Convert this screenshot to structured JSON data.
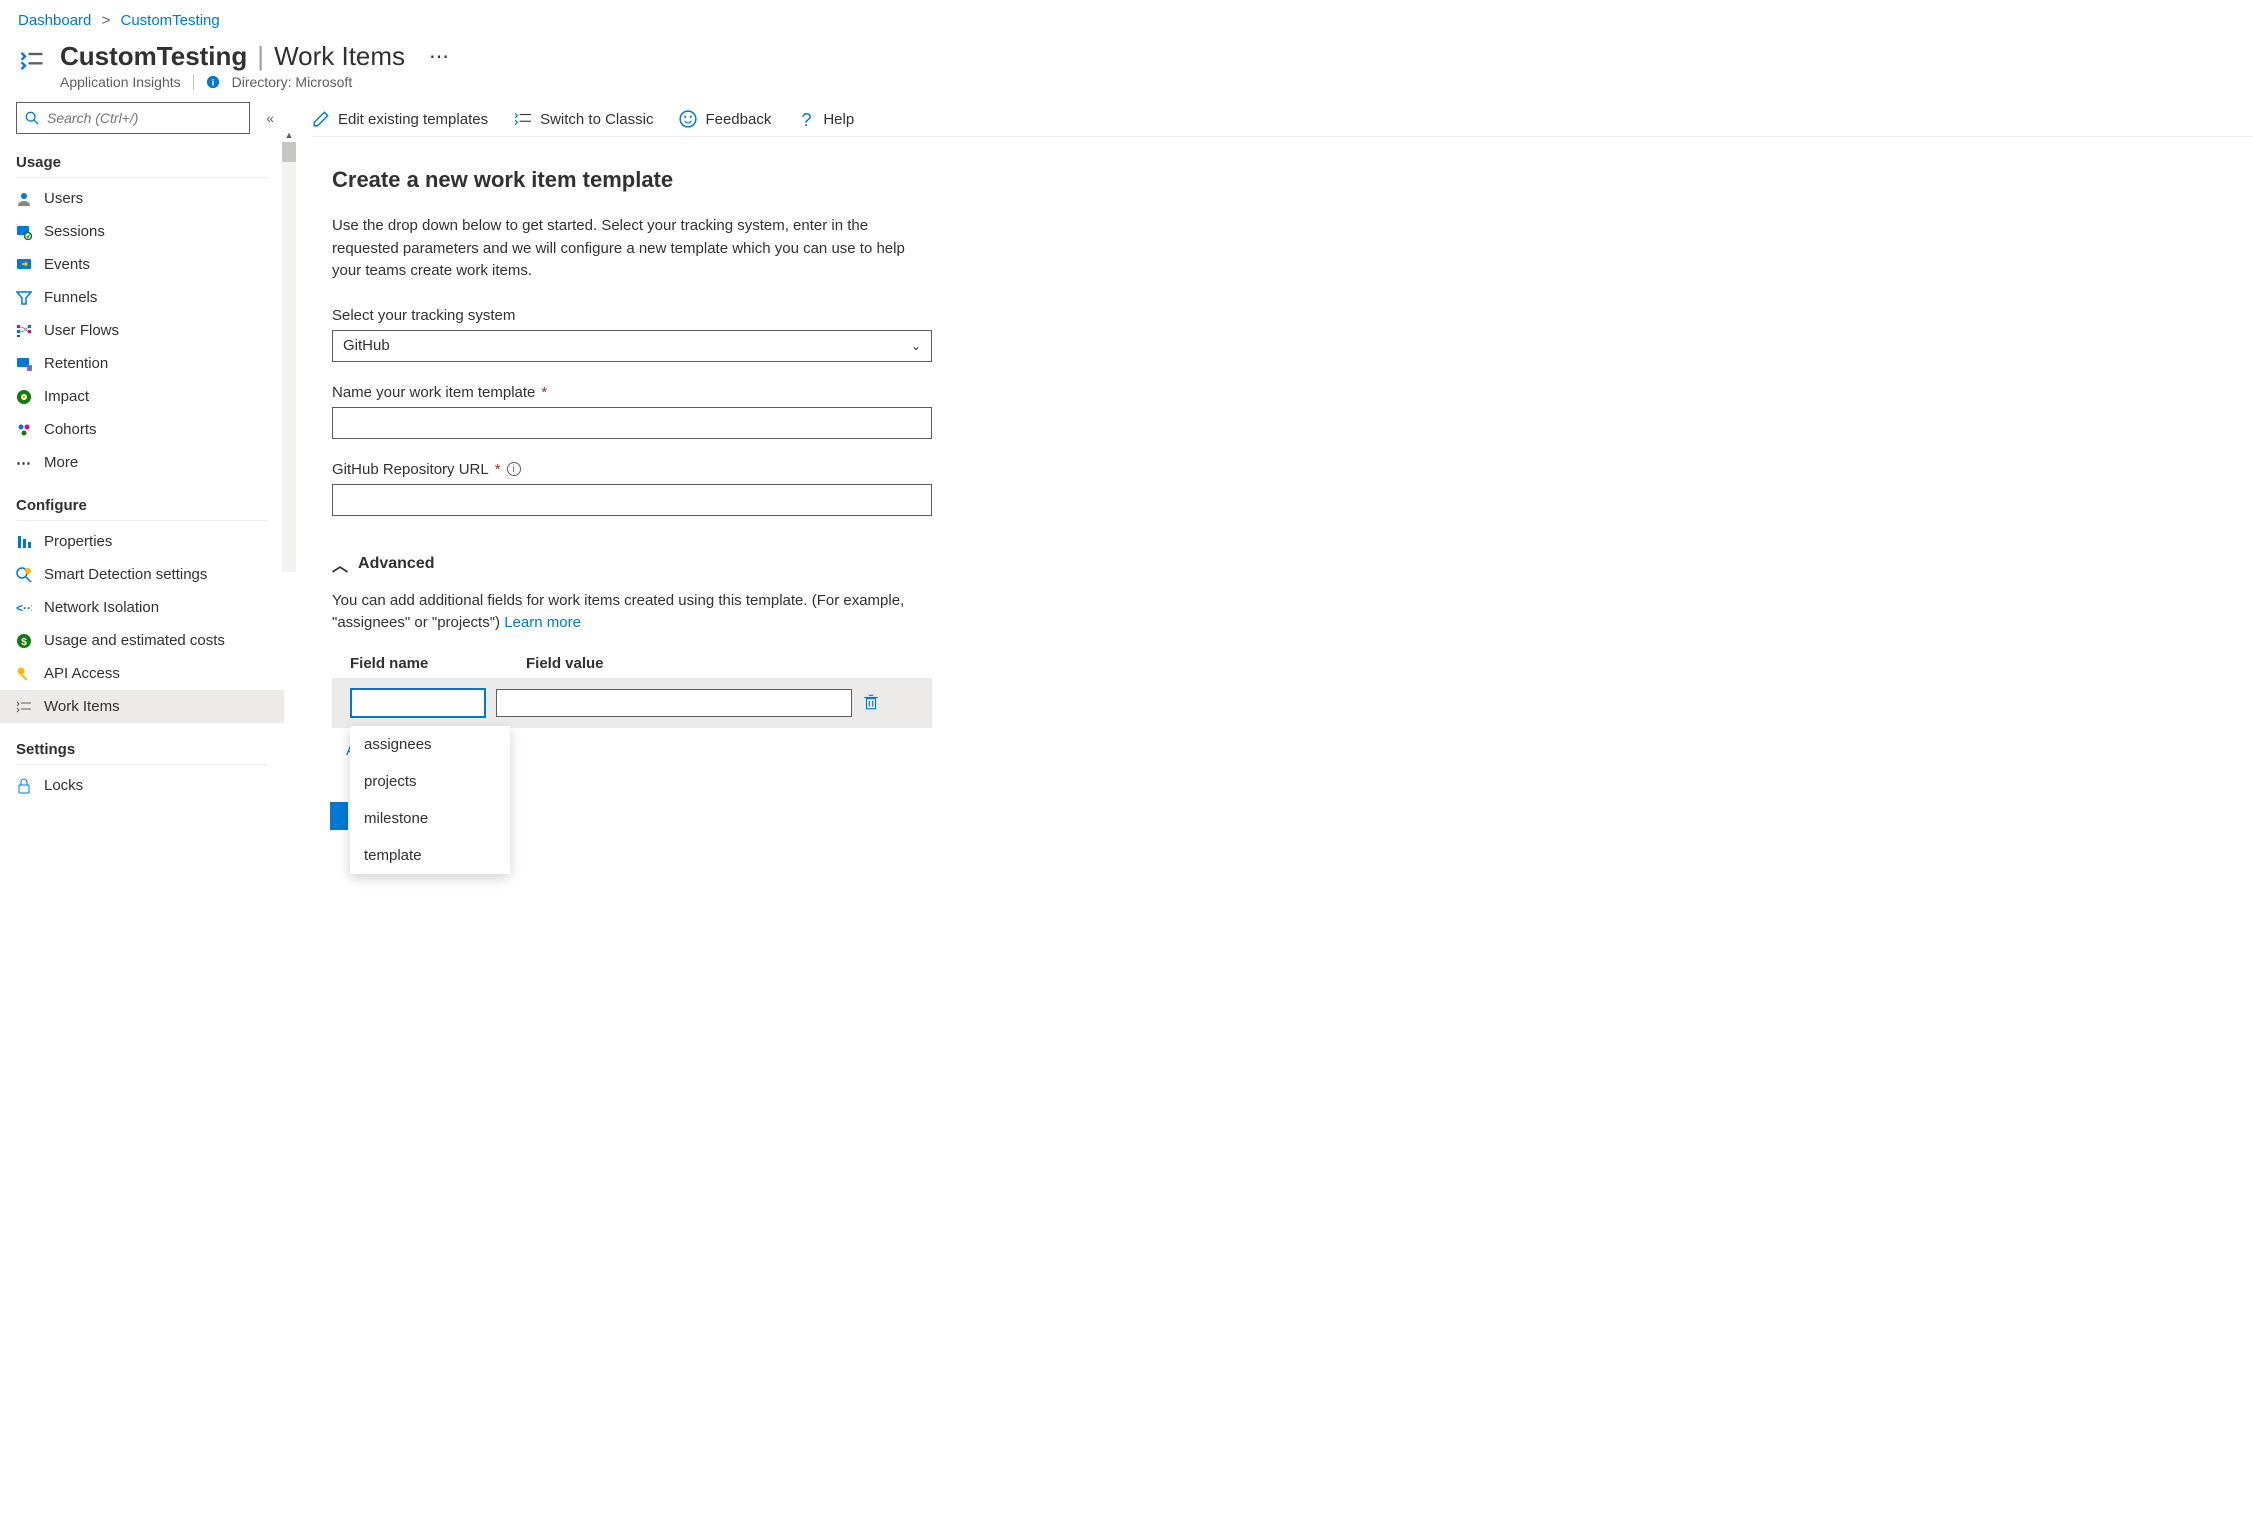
{
  "breadcrumb": {
    "root": "Dashboard",
    "current": "CustomTesting"
  },
  "header": {
    "title": "CustomTesting",
    "section": "Work Items",
    "subtitle": "Application Insights",
    "directory_label": "Directory: Microsoft"
  },
  "sidebar": {
    "search_placeholder": "Search (Ctrl+/)",
    "groups": {
      "usage": {
        "heading": "Usage",
        "items": [
          "Users",
          "Sessions",
          "Events",
          "Funnels",
          "User Flows",
          "Retention",
          "Impact",
          "Cohorts",
          "More"
        ]
      },
      "configure": {
        "heading": "Configure",
        "items": [
          "Properties",
          "Smart Detection settings",
          "Network Isolation",
          "Usage and estimated costs",
          "API Access",
          "Work Items"
        ]
      },
      "settings": {
        "heading": "Settings",
        "items": [
          "Locks"
        ]
      }
    }
  },
  "toolbar": {
    "edit": "Edit existing templates",
    "classic": "Switch to Classic",
    "feedback": "Feedback",
    "help": "Help"
  },
  "form": {
    "heading": "Create a new work item template",
    "description": "Use the drop down below to get started. Select your tracking system, enter in the requested parameters and we will configure a new template which you can use to help your teams create work items.",
    "tracking_label": "Select your tracking system",
    "tracking_value": "GitHub",
    "name_label": "Name your work item template",
    "url_label": "GitHub Repository URL"
  },
  "advanced": {
    "heading": "Advanced",
    "description": "You can add additional fields for work items created using this template. (For example, \"assignees\" or \"projects\") ",
    "learn_more": "Learn more",
    "col_name": "Field name",
    "col_value": "Field value",
    "dropdown_options": [
      "assignees",
      "projects",
      "milestone",
      "template"
    ],
    "add_link_prefix": "A"
  }
}
